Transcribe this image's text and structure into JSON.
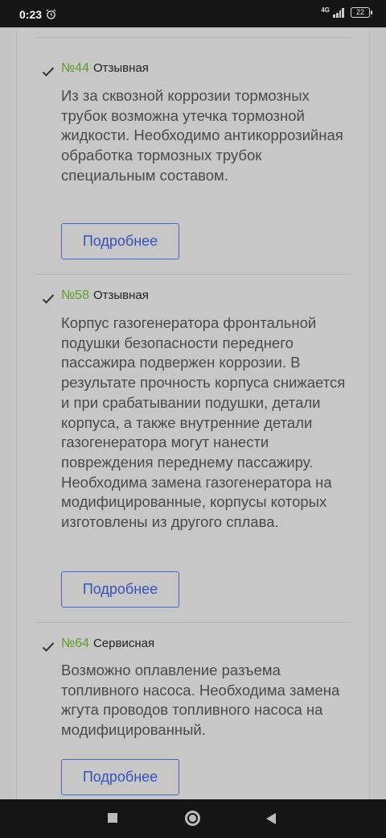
{
  "status_bar": {
    "time": "0:23",
    "network": "4G",
    "battery": "22"
  },
  "notices": [
    {
      "number": "№44",
      "type": "Отзывная",
      "text": "Из за сквозной коррозии тормозных трубок возможна утечка тормозной жидкости. Необходимо антикоррозийная обработка тормозных трубок специальным составом.",
      "button_label": "Подробнее"
    },
    {
      "number": "№58",
      "type": "Отзывная",
      "text": "Корпус газогенератора фронтальной подушки безопасности переднего пассажира подвержен коррозии. В результате прочность корпуса снижается и при срабатывании подушки, детали корпуса, а также внутренние детали газогенератора могут нанести повреждения переднему пассажиру. Необходима замена газогенератора на модифицированные, корпусы которых изготовлены из другого сплава.",
      "button_label": "Подробнее"
    },
    {
      "number": "№64",
      "type": "Сервисная",
      "text": "Возможно оплавление разъема топливного насоса. Необходима замена жгута проводов топливного насоса на модифицированный.",
      "button_label": "Подробнее"
    }
  ],
  "colors": {
    "number_green": "#5f9e2a",
    "button_blue": "#3553b8",
    "background": "#c5c5c5"
  }
}
